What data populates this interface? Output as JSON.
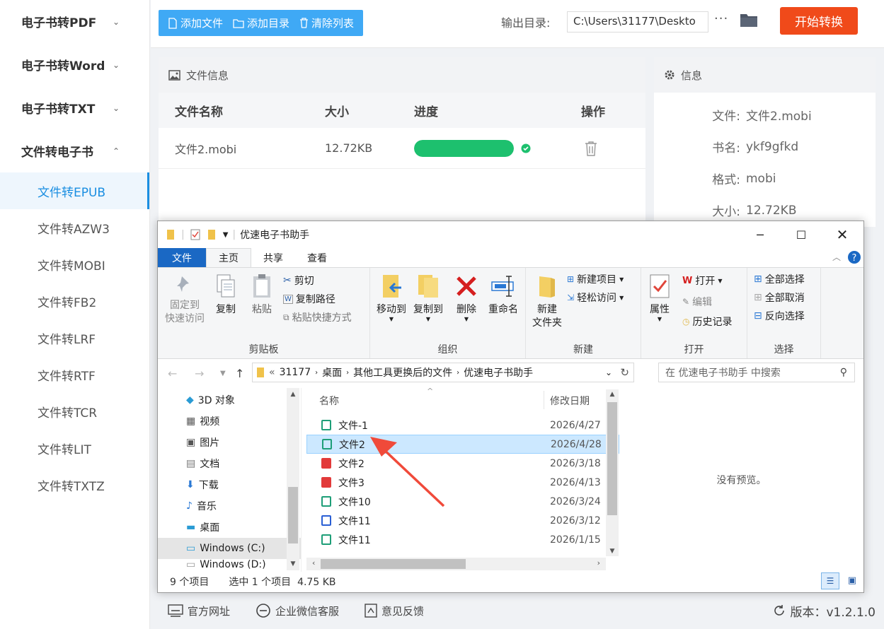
{
  "sidebar": {
    "categories": [
      {
        "label": "电子书转PDF",
        "chevron": "⌄"
      },
      {
        "label": "电子书转Word",
        "chevron": "⌄"
      },
      {
        "label": "电子书转TXT",
        "chevron": "⌄"
      },
      {
        "label": "文件转电子书",
        "chevron": "⌃"
      }
    ],
    "items": [
      "文件转EPUB",
      "文件转AZW3",
      "文件转MOBI",
      "文件转FB2",
      "文件转LRF",
      "文件转RTF",
      "文件转TCR",
      "文件转LIT",
      "文件转TXTZ"
    ]
  },
  "toolbar": {
    "add_file": "添加文件",
    "add_dir": "添加目录",
    "clear_list": "清除列表",
    "output_label": "输出目录:",
    "output_path": "C:\\Users\\31177\\Deskto",
    "more": "···",
    "start": "开始转换"
  },
  "file_panel": {
    "title": "文件信息",
    "headers": [
      "文件名称",
      "大小",
      "进度",
      "操作"
    ],
    "rows": [
      {
        "name": "文件2.mobi",
        "size": "12.72KB",
        "progress": 1.0
      }
    ]
  },
  "info_panel": {
    "title": "信息",
    "rows": [
      {
        "key": "文件:",
        "value": "文件2.mobi"
      },
      {
        "key": "书名:",
        "value": "ykf9gfkd"
      },
      {
        "key": "格式:",
        "value": "mobi"
      },
      {
        "key": "大小:",
        "value": "12.72KB"
      }
    ]
  },
  "bottom": {
    "website": "官方网址",
    "wechat": "企业微信客服",
    "feedback": "意见反馈",
    "version": "版本：v1.2.1.0"
  },
  "explorer": {
    "title": "优速电子书助手",
    "tabs": [
      "文件",
      "主页",
      "共享",
      "查看"
    ],
    "ribbon": {
      "pin": "固定到\n快速访问",
      "copy": "复制",
      "paste": "粘贴",
      "cut": "剪切",
      "copy_path": "复制路径",
      "paste_shortcut": "粘贴快捷方式",
      "clipboard": "剪贴板",
      "move_to": "移动到",
      "copy_to": "复制到",
      "delete": "删除",
      "rename": "重命名",
      "organize": "组织",
      "new_folder": "新建\n文件夹",
      "new_item": "新建项目",
      "easy_access": "轻松访问",
      "new_group": "新建",
      "properties": "属性",
      "open": "打开",
      "edit": "编辑",
      "history": "历史记录",
      "open_group": "打开",
      "select_all": "全部选择",
      "select_none": "全部取消",
      "invert": "反向选择",
      "select_group": "选择"
    },
    "breadcrumb": [
      "31177",
      "桌面",
      "其他工具更换后的文件",
      "优速电子书助手"
    ],
    "search_placeholder": "在 优速电子书助手 中搜索",
    "nav": [
      "3D 对象",
      "视频",
      "图片",
      "文档",
      "下载",
      "音乐",
      "桌面",
      "Windows (C:)",
      "Windows (D:)"
    ],
    "columns": [
      "名称",
      "修改日期"
    ],
    "files": [
      {
        "name": "文件-1",
        "date": "2026/4/27",
        "type": "epub"
      },
      {
        "name": "文件2",
        "date": "2026/4/28",
        "type": "epub"
      },
      {
        "name": "文件2",
        "date": "2026/3/18",
        "type": "pdf"
      },
      {
        "name": "文件3",
        "date": "2026/4/13",
        "type": "pdf"
      },
      {
        "name": "文件10",
        "date": "2026/3/24",
        "type": "epub"
      },
      {
        "name": "文件11",
        "date": "2026/3/12",
        "type": "word"
      },
      {
        "name": "文件11",
        "date": "2026/1/15",
        "type": "epub"
      }
    ],
    "no_preview": "没有预览。",
    "status_count": "9 个项目",
    "status_selected": "选中 1 个项目  4.75 KB"
  },
  "colors": {
    "accent": "#1a8ee1",
    "start": "#f04a1a",
    "progress": "#1dc06e",
    "toolbar": "#3fa9f5"
  }
}
